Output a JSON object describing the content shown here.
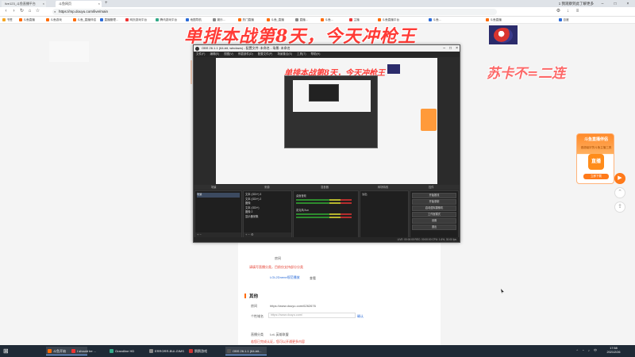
{
  "browser": {
    "tabs": [
      {
        "label": "live123_斗鱼直播平台"
      },
      {
        "label": "斗鱼网页"
      }
    ],
    "new_tab": "+",
    "menu_right": "1 我观察到此了解更多",
    "url": "https://mp.douyu.com/live/main",
    "bookmarks": [
      "书签",
      "斗鱼直播",
      "斗鱼游戏",
      "斗鱼_直播伴侣",
      "直播管理...",
      "网页游戏平台",
      "腾讯游戏平台",
      "地图导航",
      "娱乐...",
      "热门直播",
      "斗鱼_直播",
      "直播...",
      "斗鱼...",
      "主播",
      "斗鱼直播平台",
      "斗鱼...",
      "斗鱼直播",
      "百度"
    ]
  },
  "overlay": {
    "title": "单排本战第8天，今天冲枪王",
    "sub": "苏卡不=二连"
  },
  "obs": {
    "window_title": "OBS 26.1.1 (64-bit, windows) - 配置文件: 未命名 - 场景: 未命名",
    "menu": [
      "文件(F)",
      "编辑(E)",
      "视图(V)",
      "停靠部件(D)",
      "配置文件(P)",
      "场景集合(S)",
      "工具(T)",
      "帮助(H)"
    ],
    "preview_title": "单排本战第8天，今天冲枪王",
    "docks": [
      "场景",
      "来源",
      "混音器",
      "转场特效",
      "控件"
    ],
    "scenes": [
      "场景"
    ],
    "sources": [
      "文本 (GDI+) 3",
      "文本 (GDI+) 2",
      "图像",
      "文本 (GDI+)",
      "图像 2",
      "显示器采集"
    ],
    "mixer": [
      "桌面音频",
      "麦克风/Aux"
    ],
    "transition": "淡出",
    "controls": [
      "开始推流",
      "开始录制",
      "启动虚拟摄像机",
      "工作室模式",
      "设置",
      "退出"
    ],
    "status": "LIVE: 00:00:00   REC: 00:00:00   CPU: 1.6%, 30.00 fps"
  },
  "page": {
    "section_title": "其他",
    "rows": [
      {
        "label": "房间",
        "value": "https://www.douyu.com/6262676"
      },
      {
        "label": "个性域名",
        "value": "https://www.douyu.com/"
      },
      {
        "label": "直播分类",
        "value": "LoL 英雄联盟"
      }
    ],
    "note_red": "请填写直播分类，目前仅支持部分分类",
    "link1": "LOL2Dnene规范播放",
    "link2": "查看",
    "btn_confirm": "确认",
    "red_line2": "若您已完成认证，您可以开通更多内容"
  },
  "promo": {
    "title": "斗鱼直播伴侣",
    "sub": "做超级好的斗鱼主播工具",
    "icon_text": "直播",
    "btn": "立即下载"
  },
  "taskbar": {
    "items": [
      {
        "label": "斗鱼开始",
        "color": "#ff6a00"
      },
      {
        "label": "I should be ...",
        "color": "#e33"
      },
      {
        "label": "Grandline HD",
        "color": "#3a8"
      },
      {
        "label": "ERRORR-BUI-GIMS",
        "color": "#888"
      },
      {
        "label": "鹅鹅游戏",
        "color": "#c33"
      },
      {
        "label": "OBS 26.1.1 (64-bit...",
        "color": "#333"
      }
    ],
    "time": "17:58",
    "date": "2021/2/26"
  }
}
